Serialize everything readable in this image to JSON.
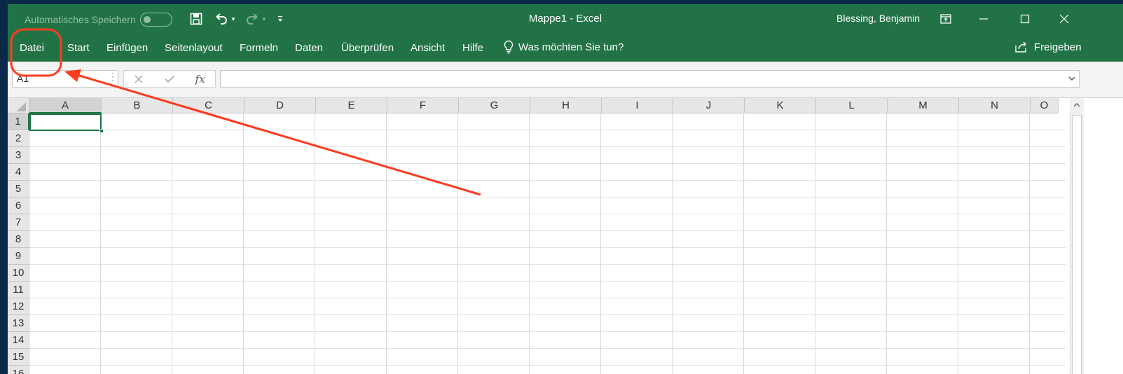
{
  "titlebar": {
    "autosave_label": "Automatisches Speichern",
    "title": "Mappe1  -  Excel",
    "user": "Blessing, Benjamin"
  },
  "ribbon": {
    "tabs": [
      {
        "label": "Datei"
      },
      {
        "label": "Start"
      },
      {
        "label": "Einfügen"
      },
      {
        "label": "Seitenlayout"
      },
      {
        "label": "Formeln"
      },
      {
        "label": "Daten"
      },
      {
        "label": "Überprüfen"
      },
      {
        "label": "Ansicht"
      },
      {
        "label": "Hilfe"
      }
    ],
    "tell_me": "Was möchten Sie tun?",
    "share": "Freigeben"
  },
  "formulabar": {
    "namebox": "A1",
    "fx": "fx",
    "value": ""
  },
  "grid": {
    "columns": [
      "A",
      "B",
      "C",
      "D",
      "E",
      "F",
      "G",
      "H",
      "I",
      "J",
      "K",
      "L",
      "M",
      "N",
      "O"
    ],
    "rows": [
      "1",
      "2",
      "3",
      "4",
      "5",
      "6",
      "7",
      "8",
      "9",
      "10",
      "11",
      "12",
      "13",
      "14",
      "15",
      "16"
    ],
    "selected_cell": "A1"
  },
  "colors": {
    "excel_green": "#217346",
    "annotation_red": "#ff3b1f"
  }
}
